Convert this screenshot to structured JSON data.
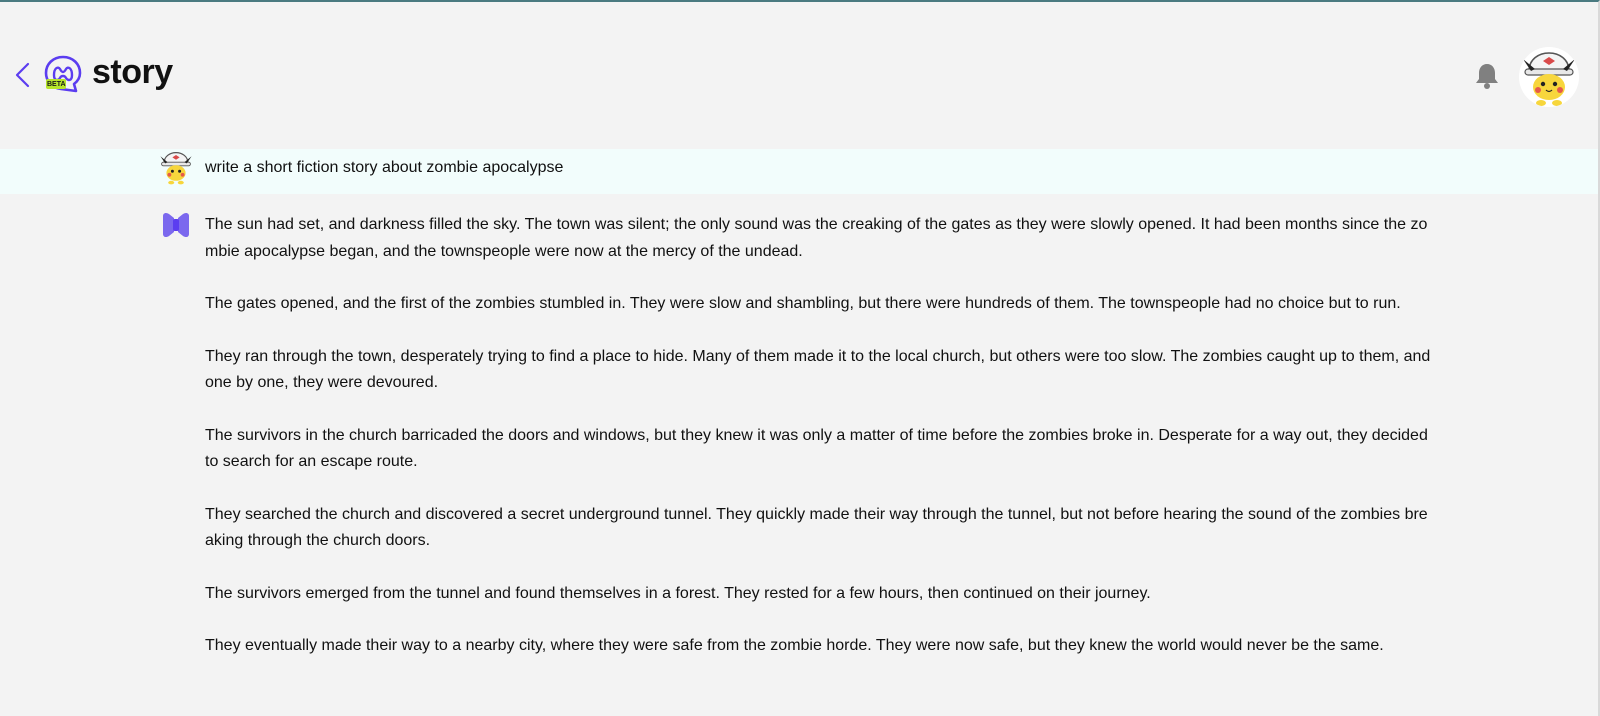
{
  "header": {
    "title": "story",
    "logo_badge": "BETA"
  },
  "prompt": {
    "text": "write a short fiction story about zombie apocalypse"
  },
  "response": {
    "paragraphs": [
      "The sun had set, and darkness filled the sky. The town was silent; the only sound was the creaking of the gates as they were slowly opened. It had been months since the zombie apocalypse began, and the townspeople were now at the mercy of the undead.",
      "The gates opened, and the first of the zombies stumbled in. They were slow and shambling, but there were hundreds of them. The townspeople had no choice but to run.",
      "They ran through the town, desperately trying to find a place to hide. Many of them made it to the local church, but others were too slow. The zombies caught up to them, and one by one, they were devoured.",
      "The survivors in the church barricaded the doors and windows, but they knew it was only a matter of time before the zombies broke in. Desperate for a way out, they decided to search for an escape route.",
      "They searched the church and discovered a secret underground tunnel. They quickly made their way through the tunnel, but not before hearing the sound of the zombies breaking through the church doors.",
      "The survivors emerged from the tunnel and found themselves in a forest. They rested for a few hours, then continued on their journey.",
      "They eventually made their way to a nearby city, where they were safe from the zombie horde. They were now safe, but they knew the world would never be the same."
    ]
  },
  "icons": {
    "back": "chevron-left-icon",
    "logo": "chat-bubble-logo-icon",
    "bell": "bell-icon",
    "user": "user-avatar-pikachu",
    "bot": "bot-bowtie-icon"
  },
  "colors": {
    "accent": "#5b3df0",
    "logo_badge": "#b6e52a",
    "bot_icon": "#7b68ee",
    "prompt_bg": "#f2fdfc",
    "page_bg": "#f3f3f3",
    "bell": "#808080"
  }
}
